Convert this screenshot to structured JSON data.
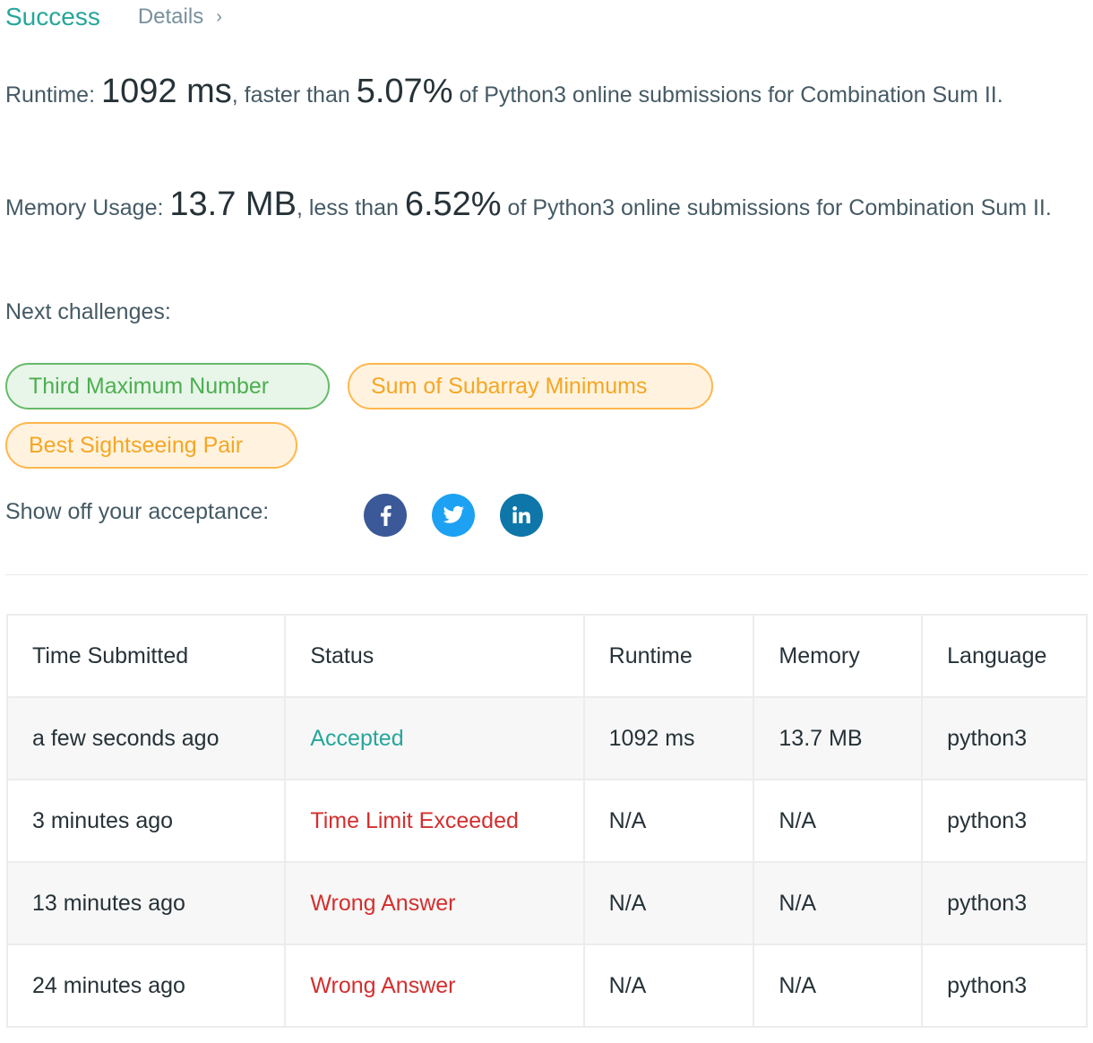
{
  "header": {
    "status": "Success",
    "details_label": "Details",
    "details_chevron": "›"
  },
  "runtime": {
    "label": "Runtime:",
    "value": "1092 ms",
    "comparison": ", faster than",
    "percent": "5.07%",
    "suffix": "of Python3 online submissions for Combination Sum II."
  },
  "memory": {
    "label": "Memory Usage:",
    "value": "13.7 MB",
    "comparison": ", less than",
    "percent": "6.52%",
    "suffix": "of Python3 online submissions for Combination Sum II."
  },
  "next_challenges": {
    "label": "Next challenges:",
    "items": [
      {
        "title": "Third Maximum Number",
        "difficulty": "easy"
      },
      {
        "title": "Sum of Subarray Minimums",
        "difficulty": "medium"
      },
      {
        "title": "Best Sightseeing Pair",
        "difficulty": "medium"
      }
    ]
  },
  "share": {
    "label": "Show off your acceptance:",
    "icons": [
      "facebook-icon",
      "twitter-icon",
      "linkedin-icon"
    ]
  },
  "submissions": {
    "headers": [
      "Time Submitted",
      "Status",
      "Runtime",
      "Memory",
      "Language"
    ],
    "rows": [
      {
        "time": "a few seconds ago",
        "status": "Accepted",
        "runtime": "1092 ms",
        "memory": "13.7 MB",
        "language": "python3"
      },
      {
        "time": "3 minutes ago",
        "status": "Time Limit Exceeded",
        "runtime": "N/A",
        "memory": "N/A",
        "language": "python3"
      },
      {
        "time": "13 minutes ago",
        "status": "Wrong Answer",
        "runtime": "N/A",
        "memory": "N/A",
        "language": "python3"
      },
      {
        "time": "24 minutes ago",
        "status": "Wrong Answer",
        "runtime": "N/A",
        "memory": "N/A",
        "language": "python3"
      }
    ]
  },
  "colors": {
    "success": "#26a69a",
    "error": "#d32f2f",
    "easy": "#4caf50",
    "medium": "#f5a623"
  }
}
